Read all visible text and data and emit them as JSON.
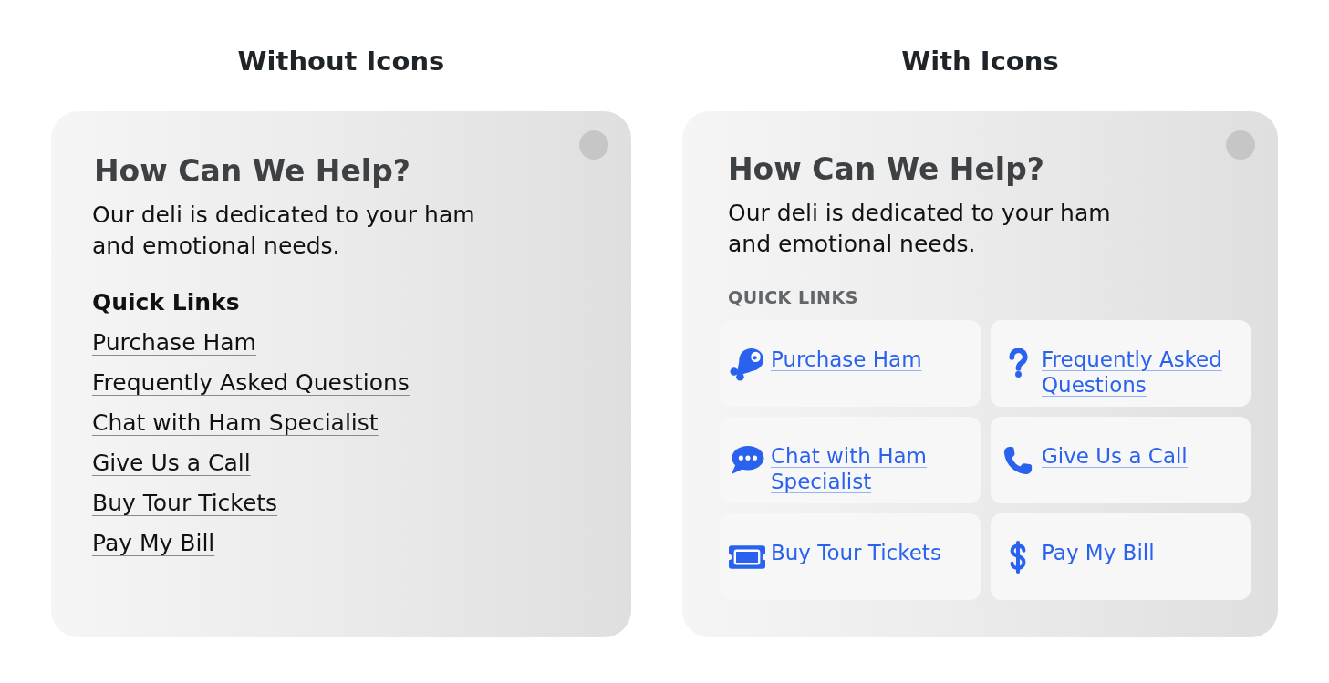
{
  "sections": [
    {
      "kind": "list",
      "heading": "Without Icons",
      "card": {
        "title": "How Can We Help?",
        "description": "Our deli is dedicated to your ham and emotional needs.",
        "links_heading": "Quick Links",
        "links": [
          {
            "label": "Purchase Ham"
          },
          {
            "label": "Frequently Asked Questions"
          },
          {
            "label": "Chat with Ham Specialist"
          },
          {
            "label": "Give Us a Call"
          },
          {
            "label": "Buy Tour Tickets"
          },
          {
            "label": "Pay My Bill"
          }
        ]
      }
    },
    {
      "kind": "tiles",
      "heading": "With Icons",
      "card": {
        "title": "How Can We Help?",
        "description": "Our deli is dedicated to your ham and emotional needs.",
        "links_heading": "QUICK LINKS",
        "links": [
          {
            "label": "Purchase Ham"
          },
          {
            "label": "Frequently Asked Questions"
          },
          {
            "label": "Chat with Ham Specialist"
          },
          {
            "label": "Give Us a Call"
          },
          {
            "label": "Buy Tour Tickets"
          },
          {
            "label": "Pay My Bill"
          }
        ]
      }
    }
  ]
}
